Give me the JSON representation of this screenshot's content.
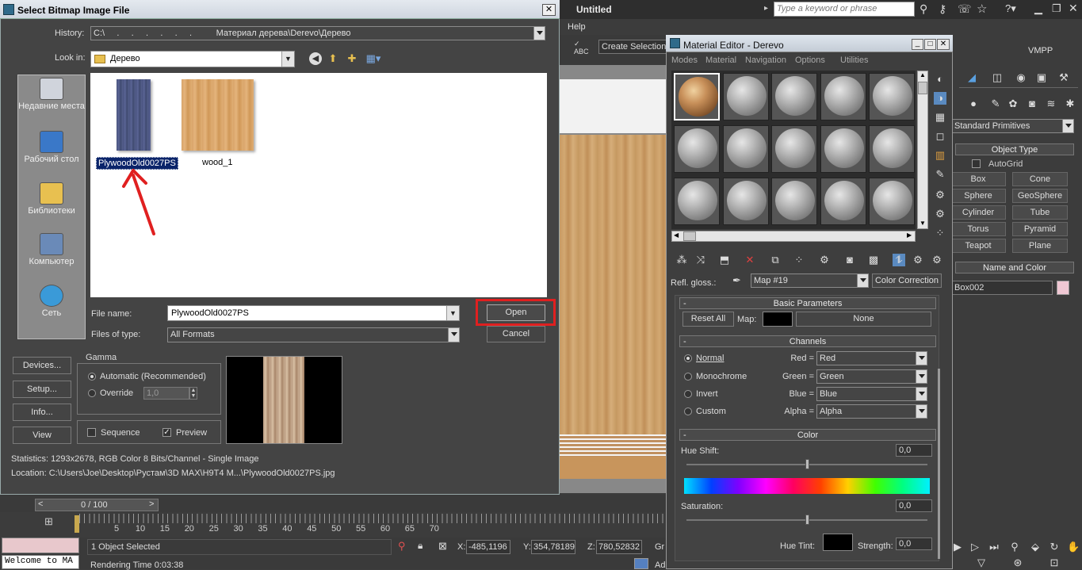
{
  "max": {
    "title": "Untitled",
    "search_placeholder": "Type a keyword or phrase",
    "help_menu": "Help",
    "create_selection": "Create Selection",
    "vmpp": "VMPP",
    "standard_primitives": "Standard Primitives",
    "object_type_header": "Object Type",
    "autogrid": "AutoGrid",
    "object_buttons": [
      "Box",
      "Cone",
      "Sphere",
      "GeoSphere",
      "Cylinder",
      "Tube",
      "Torus",
      "Pyramid",
      "Teapot",
      "Plane"
    ],
    "name_color_header": "Name and Color",
    "object_name": "Box002",
    "timeline_pos": "0 / 100",
    "ticks": [
      "5",
      "10",
      "15",
      "20",
      "25",
      "30",
      "35",
      "40",
      "45",
      "50",
      "55",
      "60",
      "65",
      "70"
    ],
    "status_selected": "1 Object Selected",
    "rendering_time": "Rendering Time  0:03:38",
    "welcome": "Welcome to MA",
    "x_label": "X:",
    "x_val": "-485,1196",
    "y_label": "Y:",
    "y_val": "354,78189",
    "z_label": "Z:",
    "z_val": "780,52832",
    "gr": "Gr",
    "ad": "Ad"
  },
  "dialog": {
    "title": "Select Bitmap Image File",
    "history_label": "History:",
    "history_value": "C:\\     .     .     .     .     .     .          Материал дерева\\Derevo\\Дерево",
    "lookin_label": "Look in:",
    "lookin_value": "Дерево",
    "sidebar": [
      "Недавние места",
      "Рабочий стол",
      "Библиотеки",
      "Компьютер",
      "Сеть"
    ],
    "files": [
      "PlywoodOld0027PS",
      "wood_1"
    ],
    "filename_label": "File name:",
    "filename_value": "PlywoodOld0027PS",
    "filetype_label": "Files of type:",
    "filetype_value": "All Formats",
    "open_button": "Open",
    "cancel_button": "Cancel",
    "devices_button": "Devices...",
    "setup_button": "Setup...",
    "info_button": "Info...",
    "view_button": "View",
    "gamma_label": "Gamma",
    "gamma_auto": "Automatic (Recommended)",
    "gamma_override": "Override",
    "gamma_value": "1,0",
    "sequence_label": "Sequence",
    "preview_label": "Preview",
    "statistics": "Statistics:  1293x2678, RGB Color 8 Bits/Channel - Single Image",
    "location": "Location:   C:\\Users\\Joe\\Desktop\\Рустам\\3D MAX\\H9T4 M...\\PlywoodOld0027PS.jpg",
    "close": "✕"
  },
  "material_editor": {
    "title": "Material Editor - Derevo",
    "menus": [
      "Modes",
      "Material",
      "Navigation",
      "Options",
      "Utilities"
    ],
    "refl_label": "Refl. gloss.:",
    "map_value": "Map #19",
    "map_type": "Color Correction",
    "basic_header": "Basic Parameters",
    "reset_all": "Reset All",
    "map_label": "Map:",
    "none_button": "None",
    "channels_header": "Channels",
    "modes": [
      "Normal",
      "Monochrome",
      "Invert",
      "Custom"
    ],
    "channel_labels": [
      "Red =",
      "Green =",
      "Blue =",
      "Alpha ="
    ],
    "channel_values": [
      "Red",
      "Green",
      "Blue",
      "Alpha"
    ],
    "color_header": "Color",
    "hue_shift_label": "Hue Shift:",
    "hue_shift_value": "0,0",
    "saturation_label": "Saturation:",
    "saturation_value": "0,0",
    "hue_tint_label": "Hue Tint:",
    "strength_label": "Strength:",
    "strength_value": "0,0"
  }
}
